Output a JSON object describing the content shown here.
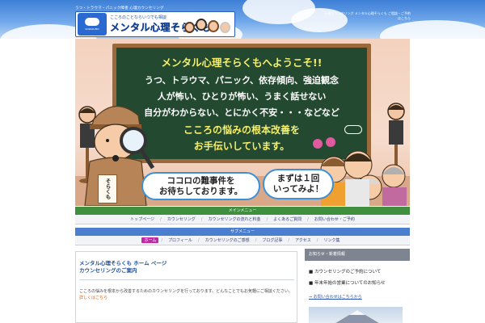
{
  "header": {
    "tagline": "うつ・トラウマ・パニック障害 心理カウンセリング",
    "right_text": "心理カウンセリング メンタル心理そらくも ご相談・ご予約はこちら",
    "logo_sub": "こころのことならいつでも相談",
    "logo_main": "メンタル心理そらくも",
    "logo_icon_text": "SORAKUMO"
  },
  "hero": {
    "board_line1": "メンタル心理そらくもへようこそ!!",
    "board_line2": "うつ、トラウマ、パニック、依存傾向、強迫観念",
    "board_line3": "人が怖い、ひとりが怖い、うまく話せない",
    "board_line4": "自分がわからない、とにかく不安・・・などなど",
    "board_line5": "こころの悩みの根本改善を",
    "board_line6": "お手伝いしています。",
    "bubble_left_1": "ココロの難事件を",
    "bubble_left_2": "お待ちしております。",
    "bubble_right_1": "まずは１回",
    "bubble_right_2": "いってみよ！",
    "sign_text": "そらくも"
  },
  "nav1": {
    "title": "メインメニュー",
    "items": [
      "トップページ",
      "カウンセリング",
      "カウンセリングの流れと料金",
      "よくあるご質問",
      "お問い合わせ・ご予約"
    ]
  },
  "nav2": {
    "title": "サブメニュー",
    "items": [
      "ホーム",
      "プロフィール",
      "カウンセリングのご感想",
      "ブログ記事",
      "アクセス",
      "リンク集"
    ],
    "active_index": 0
  },
  "main": {
    "title_line1": "メンタル心理そらくも ホーム ページ",
    "title_line2": "カウンセリングのご案内",
    "body": "こころの悩みを根本から改善するためのカウンセリングを行っております。どんなことでもお気軽にご相談ください。",
    "body_highlight": "詳しくはこちら"
  },
  "sidebar": {
    "heading": "お知らせ・新着情報",
    "items": [
      "■ カウンセリングのご予約について",
      "■ 年末年始の営業についてのお知らせ"
    ],
    "link": "⇒ お問い合わせはこちらから"
  },
  "colors": {
    "sky": "#3d7fd6",
    "chalkboard": "#234a30",
    "chalk_yellow": "#f6ee6a",
    "nav_green": "#3f8f3f",
    "nav_blue": "#4a7fd0",
    "active_magenta": "#c02aa8",
    "highlight_orange": "#d4620e"
  }
}
